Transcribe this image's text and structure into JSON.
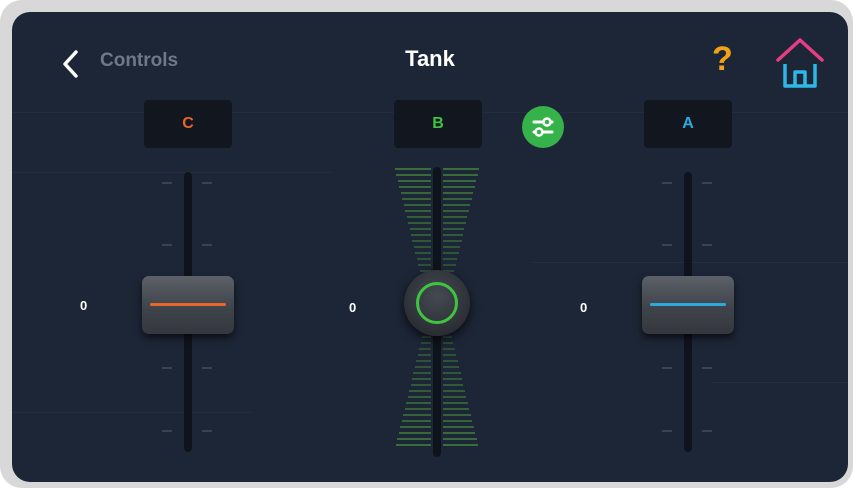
{
  "header": {
    "back_label": "Controls",
    "title": "Tank"
  },
  "help": {
    "label": "?"
  },
  "channels": {
    "c": {
      "label": "C",
      "color": "#e8652b"
    },
    "b": {
      "label": "B",
      "color": "#3ec43f"
    },
    "a": {
      "label": "A",
      "color": "#2fa8e0"
    }
  },
  "sliders": {
    "c": {
      "value_label": "0",
      "line_color": "#e8652b"
    },
    "b": {
      "value_label": "0",
      "ring_color": "#3ec43f"
    },
    "a": {
      "value_label": "0",
      "line_color": "#2fa8e0"
    }
  },
  "icons": {
    "back": "chevron-left-icon",
    "help": "question-mark-icon",
    "home": "home-icon",
    "swap": "swap-channels-icon"
  },
  "colors": {
    "background": "#1d2637",
    "help": "#f2a118",
    "home_roof": "#e83d84",
    "home_body": "#2fb7e8",
    "swap_button": "#36b24a"
  }
}
